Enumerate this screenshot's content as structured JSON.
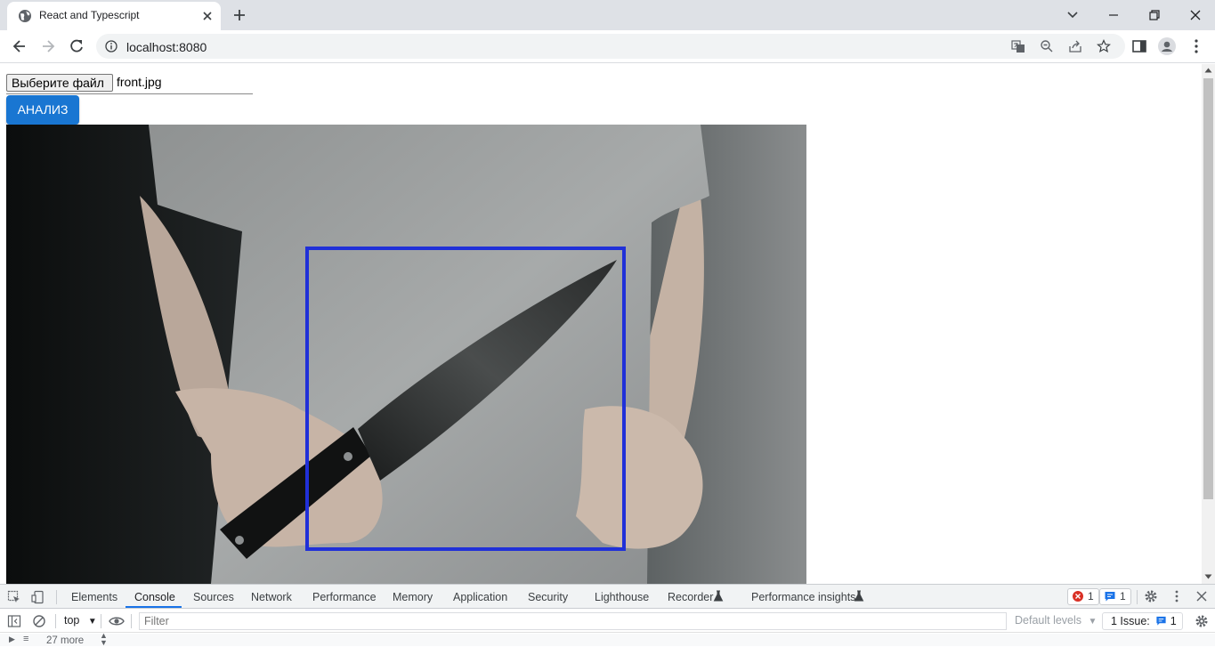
{
  "browser": {
    "tab_title": "React and Typescript",
    "url": "localhost:8080"
  },
  "page": {
    "file_button_label": "Выберите файл",
    "file_name": "front.jpg",
    "analyze_button_label": "АНАЛИЗ",
    "detection_box_color": "#2030d8",
    "accent_color": "#1976d2"
  },
  "devtools": {
    "tabs": [
      "Elements",
      "Console",
      "Sources",
      "Network",
      "Performance",
      "Memory",
      "Application",
      "Security",
      "Lighthouse",
      "Recorder",
      "Performance insights"
    ],
    "active_tab": "Console",
    "error_count": "1",
    "message_count": "1",
    "context": "top",
    "filter_placeholder": "Filter",
    "levels_label": "Default levels",
    "issues_label": "1 Issue:",
    "issues_count": "1",
    "more_label": "27 more"
  }
}
